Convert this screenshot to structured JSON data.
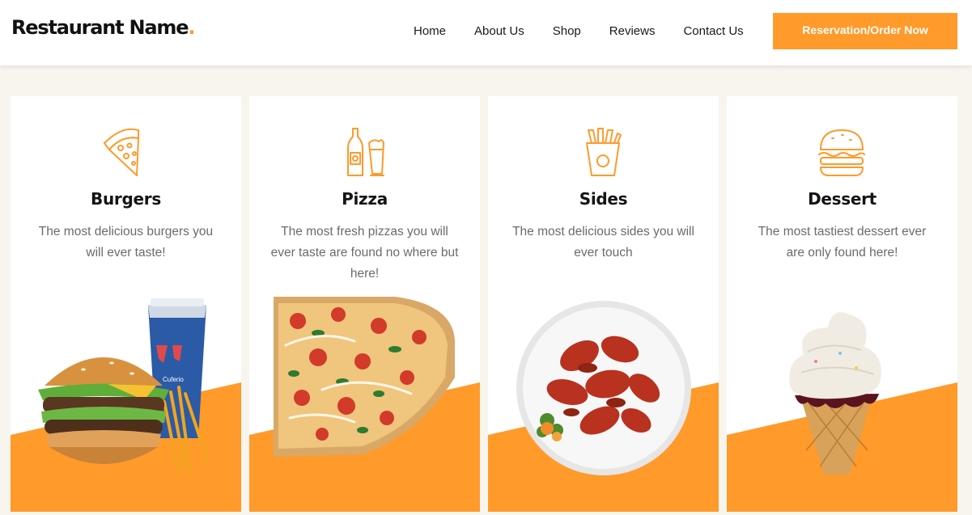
{
  "brand": {
    "name": "Restaurant Name",
    "dot": "."
  },
  "nav": {
    "items": [
      "Home",
      "About Us",
      "Shop",
      "Reviews",
      "Contact Us"
    ]
  },
  "cta": {
    "label": "Reservation/Order Now"
  },
  "colors": {
    "accent": "#ff9a2b",
    "text": "#141414",
    "muted": "#6b6b6b",
    "background": "#f8f5ef"
  },
  "cards": [
    {
      "title": "Burgers",
      "description": "The most delicious burgers you will ever taste!",
      "icon": "pizza-slice-icon",
      "photo": "burger-meal-photo"
    },
    {
      "title": "Pizza",
      "description": "The most fresh pizzas you will ever taste are found no where but here!",
      "icon": "bottle-and-beer-icon",
      "photo": "pizza-photo"
    },
    {
      "title": "Sides",
      "description": "The most delicious sides you will ever touch",
      "icon": "fries-icon",
      "photo": "chicken-wings-plate-photo"
    },
    {
      "title": "Dessert",
      "description": "The most tastiest dessert ever are only found here!",
      "icon": "burger-icon",
      "photo": "ice-cream-cone-photo"
    }
  ],
  "photo_text": {
    "cup_brand": "Cuferio"
  }
}
